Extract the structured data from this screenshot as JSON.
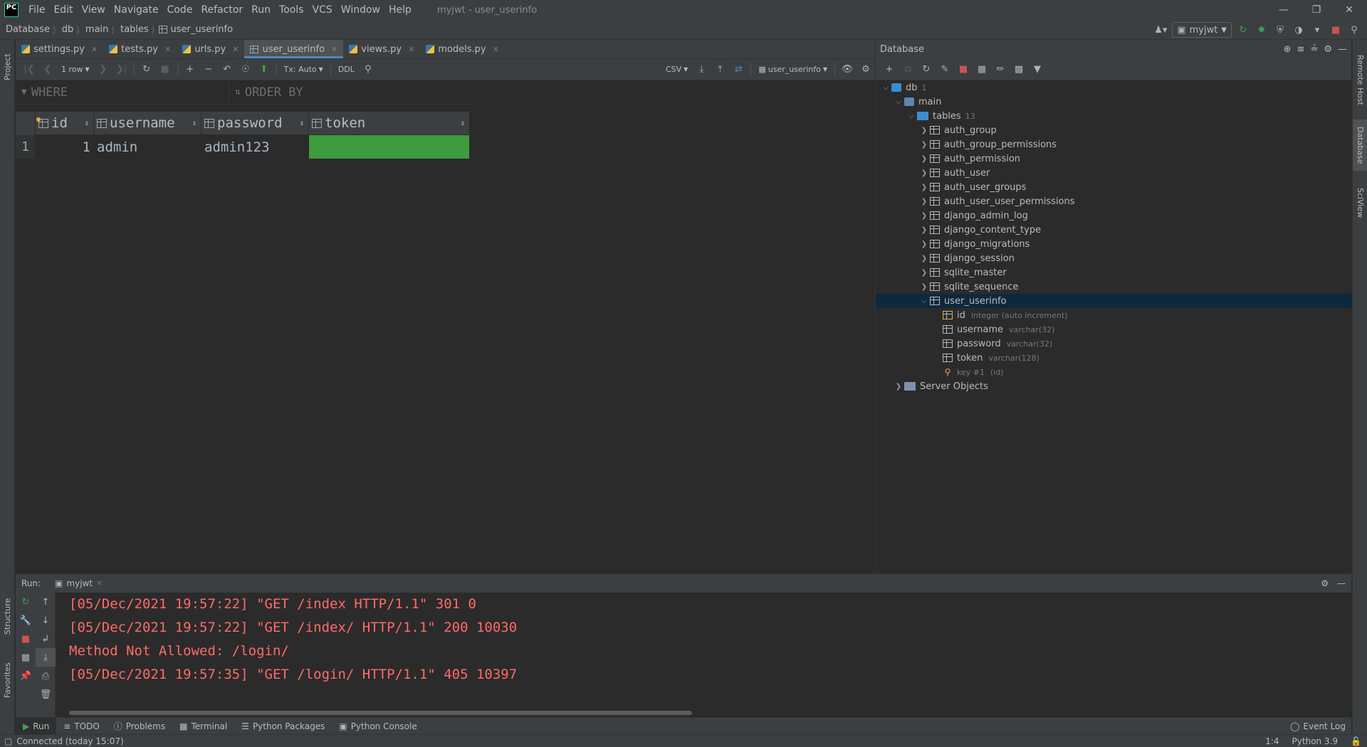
{
  "app": {
    "logo": "PC",
    "title": "myjwt - user_userinfo",
    "menu": [
      "File",
      "Edit",
      "View",
      "Navigate",
      "Code",
      "Refactor",
      "Run",
      "Tools",
      "VCS",
      "Window",
      "Help"
    ]
  },
  "breadcrumb": [
    "Database",
    "db",
    "main",
    "tables",
    "user_userinfo"
  ],
  "run_config": "myjwt",
  "tabs": [
    {
      "label": "settings.py",
      "kind": "python",
      "active": false
    },
    {
      "label": "tests.py",
      "kind": "python",
      "active": false
    },
    {
      "label": "urls.py",
      "kind": "python",
      "active": false
    },
    {
      "label": "user_userinfo",
      "kind": "table",
      "active": true
    },
    {
      "label": "views.py",
      "kind": "python",
      "active": false
    },
    {
      "label": "models.py",
      "kind": "python",
      "active": false
    }
  ],
  "grid_toolbar": {
    "rows_label": "1 row",
    "tx_label": "Tx: Auto",
    "ddl_label": "DDL",
    "export_format": "CSV",
    "table_selector": "user_userinfo"
  },
  "filter": {
    "where_label": "WHERE",
    "order_label": "ORDER BY"
  },
  "grid": {
    "columns": [
      {
        "name": "id",
        "primary_key": true
      },
      {
        "name": "username",
        "primary_key": false
      },
      {
        "name": "password",
        "primary_key": false
      },
      {
        "name": "token",
        "primary_key": false
      }
    ],
    "rows": [
      {
        "row_number": "1",
        "id": "1",
        "username": "admin",
        "password": "admin123",
        "token": ""
      }
    ],
    "selected_cell_color": "#3e9b3e"
  },
  "database_panel": {
    "title": "Database",
    "tree": {
      "db_label": "db",
      "db_badge": "1",
      "schema_label": "main",
      "tables_label": "tables",
      "tables_count": "13",
      "tables": [
        "auth_group",
        "auth_group_permissions",
        "auth_permission",
        "auth_user",
        "auth_user_groups",
        "auth_user_user_permissions",
        "django_admin_log",
        "django_content_type",
        "django_migrations",
        "django_session",
        "sqlite_master",
        "sqlite_sequence",
        "user_userinfo"
      ],
      "selected_table": "user_userinfo",
      "columns": [
        {
          "name": "id",
          "type": "integer (auto increment)"
        },
        {
          "name": "username",
          "type": "varchar(32)"
        },
        {
          "name": "password",
          "type": "varchar(32)"
        },
        {
          "name": "token",
          "type": "varchar(128)"
        }
      ],
      "key": {
        "name": "key #1",
        "columns": "(id)"
      },
      "server_objects_label": "Server Objects"
    }
  },
  "side_tabs": {
    "left": [
      "Project",
      "Structure",
      "Favorites"
    ],
    "right": [
      "Remote Host",
      "Database",
      "SciView"
    ]
  },
  "run_window": {
    "label": "Run:",
    "tab_label": "myjwt",
    "lines": [
      "[05/Dec/2021 19:57:22] \"GET /index HTTP/1.1\" 301 0",
      "[05/Dec/2021 19:57:22] \"GET /index/ HTTP/1.1\" 200 10030",
      "Method Not Allowed: /login/",
      "[05/Dec/2021 19:57:35] \"GET /login/ HTTP/1.1\" 405 10397"
    ],
    "text_color": "#ff6b68"
  },
  "tool_buttons": [
    "Run",
    "TODO",
    "Problems",
    "Terminal",
    "Python Packages",
    "Python Console"
  ],
  "event_log": "Event Log",
  "status": {
    "message": "Connected (today 15:07)",
    "position": "1:4",
    "interpreter": "Python 3.9"
  }
}
